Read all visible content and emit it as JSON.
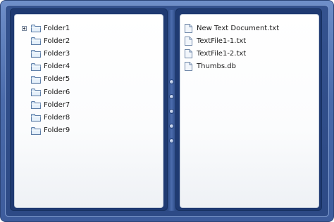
{
  "tree": {
    "items": [
      {
        "label": "Folder1",
        "expandable": true
      },
      {
        "label": "Folder2",
        "expandable": false
      },
      {
        "label": "Folder3",
        "expandable": false
      },
      {
        "label": "Folder4",
        "expandable": false
      },
      {
        "label": "Folder5",
        "expandable": false
      },
      {
        "label": "Folder6",
        "expandable": false
      },
      {
        "label": "Folder7",
        "expandable": false
      },
      {
        "label": "Folder8",
        "expandable": false
      },
      {
        "label": "Folder9",
        "expandable": false
      }
    ],
    "icon": "folder-icon",
    "expander_icon": "plus-expander-icon"
  },
  "files": {
    "items": [
      {
        "label": "New Text Document.txt"
      },
      {
        "label": "TextFile1-1.txt"
      },
      {
        "label": "TextFile1-2.txt"
      },
      {
        "label": "Thumbs.db"
      }
    ],
    "icon": "file-icon"
  },
  "colors": {
    "frame": "#4a6bab",
    "frame_dark": "#2d4a86",
    "pane_bg": "#ffffff",
    "folder_fill": "#cfe0f1",
    "folder_stroke": "#5f7fa8"
  }
}
